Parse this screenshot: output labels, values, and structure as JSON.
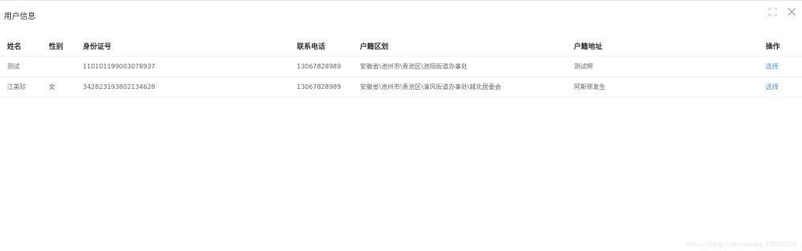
{
  "dialog": {
    "title": "用户信息",
    "icons": {
      "fullscreen": "fullscreen-icon",
      "close": "close-icon"
    }
  },
  "table": {
    "headers": {
      "name": "姓名",
      "gender": "性别",
      "id_number": "身份证号",
      "phone": "联系电话",
      "region": "户籍区划",
      "address": "户籍地址",
      "action": "操作"
    },
    "rows": [
      {
        "name": "测试",
        "gender": "",
        "id_number": "110101199003078937",
        "phone": "13067828989",
        "region": "安徽省\\池州市\\贵池区\\池阳街道办事处",
        "address": "测试啊",
        "action": "选择"
      },
      {
        "name": "江美珍",
        "gender": "女",
        "id_number": "342823193802134628",
        "phone": "13067828989",
        "region": "安徽省\\池州市\\贵池区\\清风街道办事处\\城北居委会",
        "address": "阿斯顿发生",
        "action": "选择"
      }
    ]
  },
  "watermark": "https://blog.csdn.net/qq_19550120",
  "colors": {
    "link": "#3a8ee6",
    "border": "#eeeeee",
    "text": "#666666"
  }
}
